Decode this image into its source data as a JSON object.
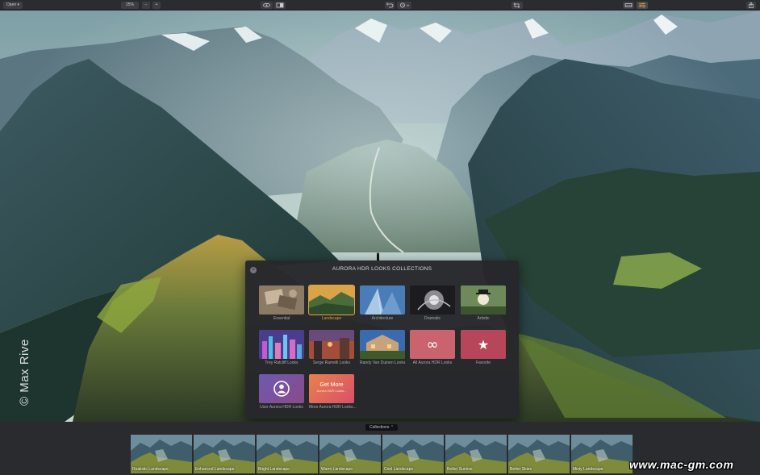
{
  "toolbar": {
    "open_label": "Open ▾",
    "zoom_value": "25%",
    "zoom_out_label": "−",
    "zoom_in_label": "+"
  },
  "watermark": "© Max Rive",
  "dialog": {
    "title": "AURORA HDR LOOKS COLLECTIONS",
    "close_label": "×",
    "tiles": [
      {
        "label": "Essential",
        "icon": "essential-thumb",
        "selected": false
      },
      {
        "label": "Landscape",
        "icon": "landscape-thumb",
        "selected": true
      },
      {
        "label": "Architecture",
        "icon": "architecture-thumb",
        "selected": false
      },
      {
        "label": "Dramatic",
        "icon": "dramatic-thumb",
        "selected": false
      },
      {
        "label": "Artistic",
        "icon": "artistic-thumb",
        "selected": false
      },
      {
        "label": "Trey Ratcliff Looks",
        "icon": "city-thumb",
        "selected": false
      },
      {
        "label": "Serge Ramelli Looks",
        "icon": "paris-thumb",
        "selected": false
      },
      {
        "label": "Randy Van Duinen Looks",
        "icon": "house-thumb",
        "selected": false
      },
      {
        "label": "All Aurora HDR Looks",
        "icon": "infinity-icon",
        "glyph": "∞",
        "selected": false
      },
      {
        "label": "Favorite",
        "icon": "star-icon",
        "glyph": "★",
        "selected": false
      },
      {
        "label": "User Aurora HDR Looks",
        "icon": "user-icon",
        "selected": false
      },
      {
        "label": "More Aurora HDR Looks...",
        "icon": "get-more-thumb",
        "selected": false,
        "thumb_title": "Get More",
        "thumb_sub": "Aurora HDR Looks..."
      }
    ]
  },
  "bottom": {
    "collections_label": "Collections ⌃",
    "filmstrip": [
      "Realistic Landscape",
      "Enhanced Landscape",
      "Bright Landscape",
      "Warm Landscape",
      "Cool Landscape",
      "Better Sunrise",
      "Better Skies",
      "Misty Landscape"
    ]
  },
  "site_mark": "www.mac-gm.com",
  "colors": {
    "accent": "#e3a53a",
    "panel": "#26272b",
    "toolbar": "#2b2c30"
  }
}
